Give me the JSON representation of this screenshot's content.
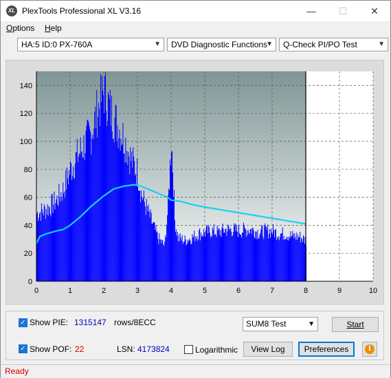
{
  "window": {
    "title": "PlexTools Professional XL V3.16",
    "app_icon_text": "XL",
    "minimize": "—",
    "maximize": "☐",
    "close": "✕"
  },
  "menu": {
    "items": [
      {
        "label": "Options",
        "accel": "O",
        "rest": "ptions"
      },
      {
        "label": "Help",
        "accel": "H",
        "rest": "elp"
      }
    ]
  },
  "toolbar": {
    "device": "HA:5 ID:0  PX-760A",
    "function": "DVD Diagnostic Functions",
    "test": "Q-Check PI/PO Test"
  },
  "chart_data": {
    "type": "area",
    "title": "",
    "xlabel": "",
    "ylabel": "",
    "xlim": [
      0,
      10
    ],
    "ylim": [
      0,
      150
    ],
    "x_ticks": [
      "0",
      "1",
      "2",
      "3",
      "4",
      "5",
      "6",
      "7",
      "8",
      "9",
      "10"
    ],
    "y_ticks": [
      "0",
      "20",
      "40",
      "60",
      "80",
      "100",
      "120",
      "140"
    ],
    "grid": true,
    "data_end_x": 8,
    "series": [
      {
        "kind": "bars",
        "color": "#0000ff",
        "x": [
          0,
          0.2,
          0.4,
          0.6,
          0.8,
          1.0,
          1.2,
          1.4,
          1.6,
          1.8,
          2.0,
          2.2,
          2.4,
          2.6,
          2.8,
          3.0,
          3.1,
          3.2,
          3.4,
          3.6,
          3.8,
          3.9,
          4.0,
          4.05,
          4.1,
          4.2,
          4.4,
          4.6,
          4.8,
          5.0,
          5.2,
          5.4,
          5.6,
          5.8,
          6.0,
          6.2,
          6.4,
          6.6,
          6.8,
          7.0,
          7.2,
          7.4,
          7.6,
          7.8,
          8.0
        ],
        "values": [
          50,
          52,
          55,
          60,
          68,
          82,
          92,
          100,
          108,
          125,
          140,
          125,
          115,
          105,
          90,
          80,
          65,
          58,
          45,
          32,
          26,
          55,
          105,
          80,
          45,
          32,
          30,
          32,
          35,
          36,
          37,
          36,
          38,
          38,
          37,
          38,
          38,
          36,
          37,
          37,
          35,
          35,
          33,
          33,
          30
        ]
      },
      {
        "kind": "line",
        "color": "#18d0ee",
        "x": [
          0,
          0.1,
          0.3,
          0.6,
          0.8,
          1.0,
          1.3,
          1.6,
          2.0,
          2.3,
          2.6,
          2.9,
          3.1,
          3.3,
          3.6,
          3.9,
          4.0,
          4.3,
          4.6,
          5.0,
          5.5,
          6.0,
          6.5,
          7.0,
          7.5,
          8.0
        ],
        "values": [
          27,
          32,
          34,
          36,
          37,
          40,
          46,
          53,
          61,
          66,
          68,
          69,
          68,
          66,
          63,
          60,
          58,
          57,
          55,
          53,
          51,
          49,
          47,
          45,
          43,
          41
        ]
      }
    ],
    "colors": {
      "plot_bg_top": "#7f9595",
      "plot_bg_bottom": "#ffffff",
      "grid": "#555555"
    }
  },
  "controls": {
    "show_pie_label": "Show PIE:",
    "show_pie_value": "1315147",
    "pie_unit": "rows/8ECC",
    "show_pof_label": "Show POF:",
    "show_pof_value": "22",
    "lsn_label": "LSN:",
    "lsn_value": "4173824",
    "logarithmic_label": "Logarithmic",
    "test_select": "SUM8 Test",
    "start_button": "Start",
    "view_log_button": "View Log",
    "preferences_button": "Preferences",
    "info_icon": "i",
    "check_mark": "✓"
  },
  "status": {
    "text": "Ready"
  }
}
